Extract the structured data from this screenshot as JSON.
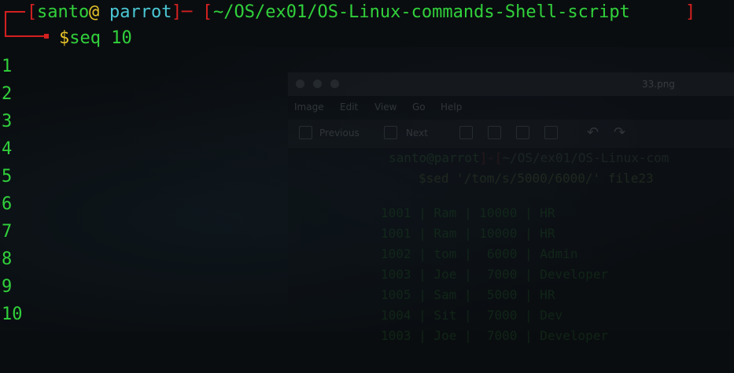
{
  "prompt": {
    "open_bracket": "[",
    "user": "santo",
    "at": "@",
    "host": "parrot",
    "close_bracket": "]",
    "separator": "─",
    "path_open": "[",
    "path": "~/OS/ex01/OS-Linux-commands-Shell-script",
    "path_close": "]"
  },
  "command": {
    "dollar": "$",
    "text": "seq 10"
  },
  "output": [
    "1",
    "2",
    "3",
    "4",
    "5",
    "6",
    "7",
    "8",
    "9",
    "10"
  ],
  "ghost_window": {
    "title": "33.png",
    "menu": [
      "Image",
      "Edit",
      "View",
      "Go",
      "Help"
    ],
    "toolbar": {
      "previous": "Previous",
      "next": "Next"
    },
    "prompt_user": "santo@parrot",
    "prompt_path": "~/OS/ex01/OS-Linux-com",
    "command": "$sed '/tom/s/5000/6000/' file23",
    "rows": [
      "1001 | Ram | 10000 | HR",
      "1001 | Ram | 10000 | HR",
      "1002 | tom |  6000 | Admin",
      "1003 | Joe |  7000 | Developer",
      "1005 | Sam |  5000 | HR",
      "1004 | Sit |  7000 | Dev",
      "1003 | Joe |  7000 | Developer"
    ]
  },
  "colors": {
    "background": "#0a0d10",
    "prompt_red": "#d42020",
    "text_green": "#31d13b",
    "host_cyan": "#4ac8d4",
    "dollar_yellow": "#e6c229"
  }
}
